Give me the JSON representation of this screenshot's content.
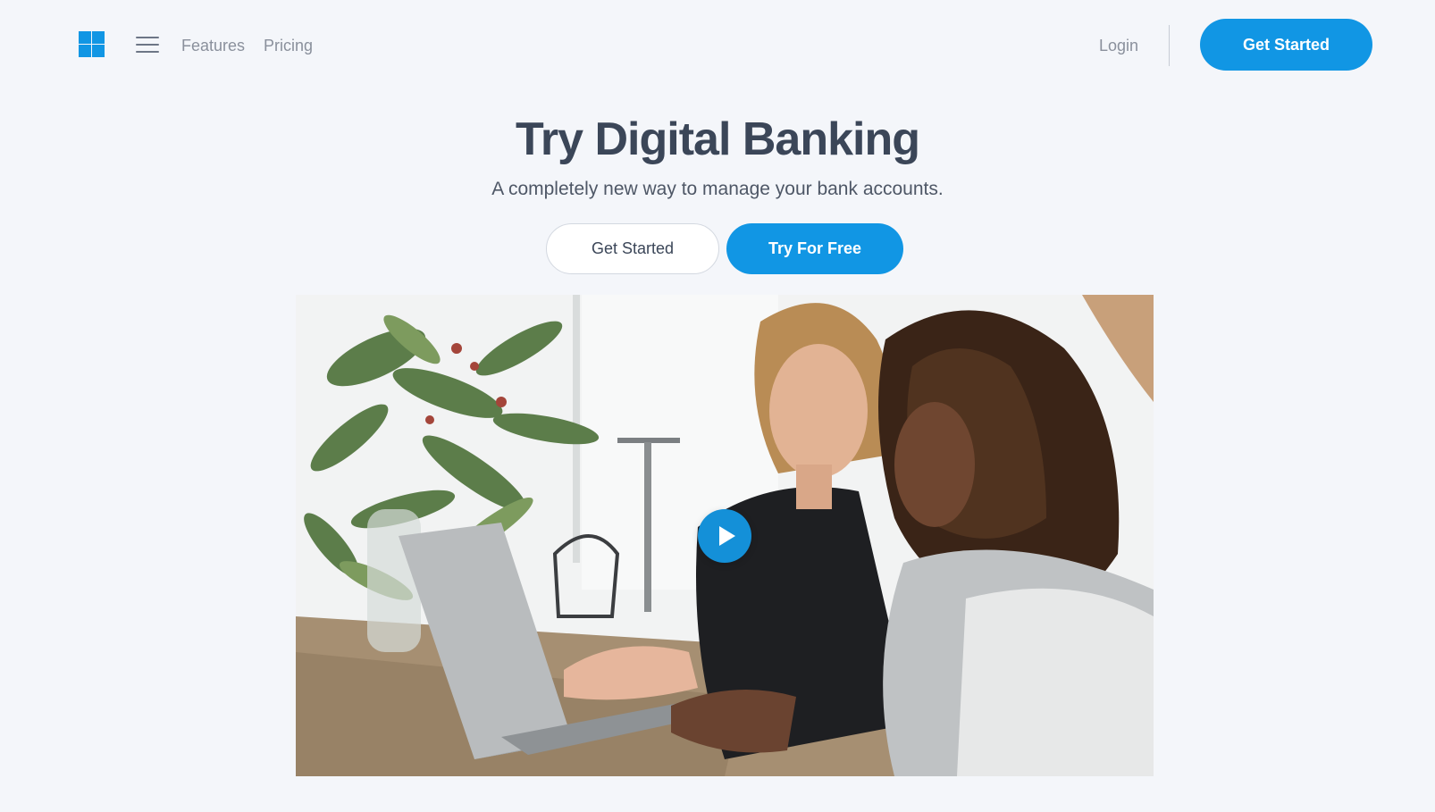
{
  "nav": {
    "links": {
      "features": "Features",
      "pricing": "Pricing",
      "login": "Login"
    },
    "cta_label": "Get Started"
  },
  "hero": {
    "title": "Try Digital Banking",
    "subtitle": "A completely new way to manage your bank accounts.",
    "primary_button": "Get Started",
    "secondary_button": "Try For Free"
  },
  "colors": {
    "accent": "#1196e4",
    "background": "#f4f6fa",
    "heading": "#3b4658"
  },
  "icons": {
    "logo": "windows-logo-icon",
    "menu": "hamburger-menu-icon",
    "play": "play-icon"
  }
}
